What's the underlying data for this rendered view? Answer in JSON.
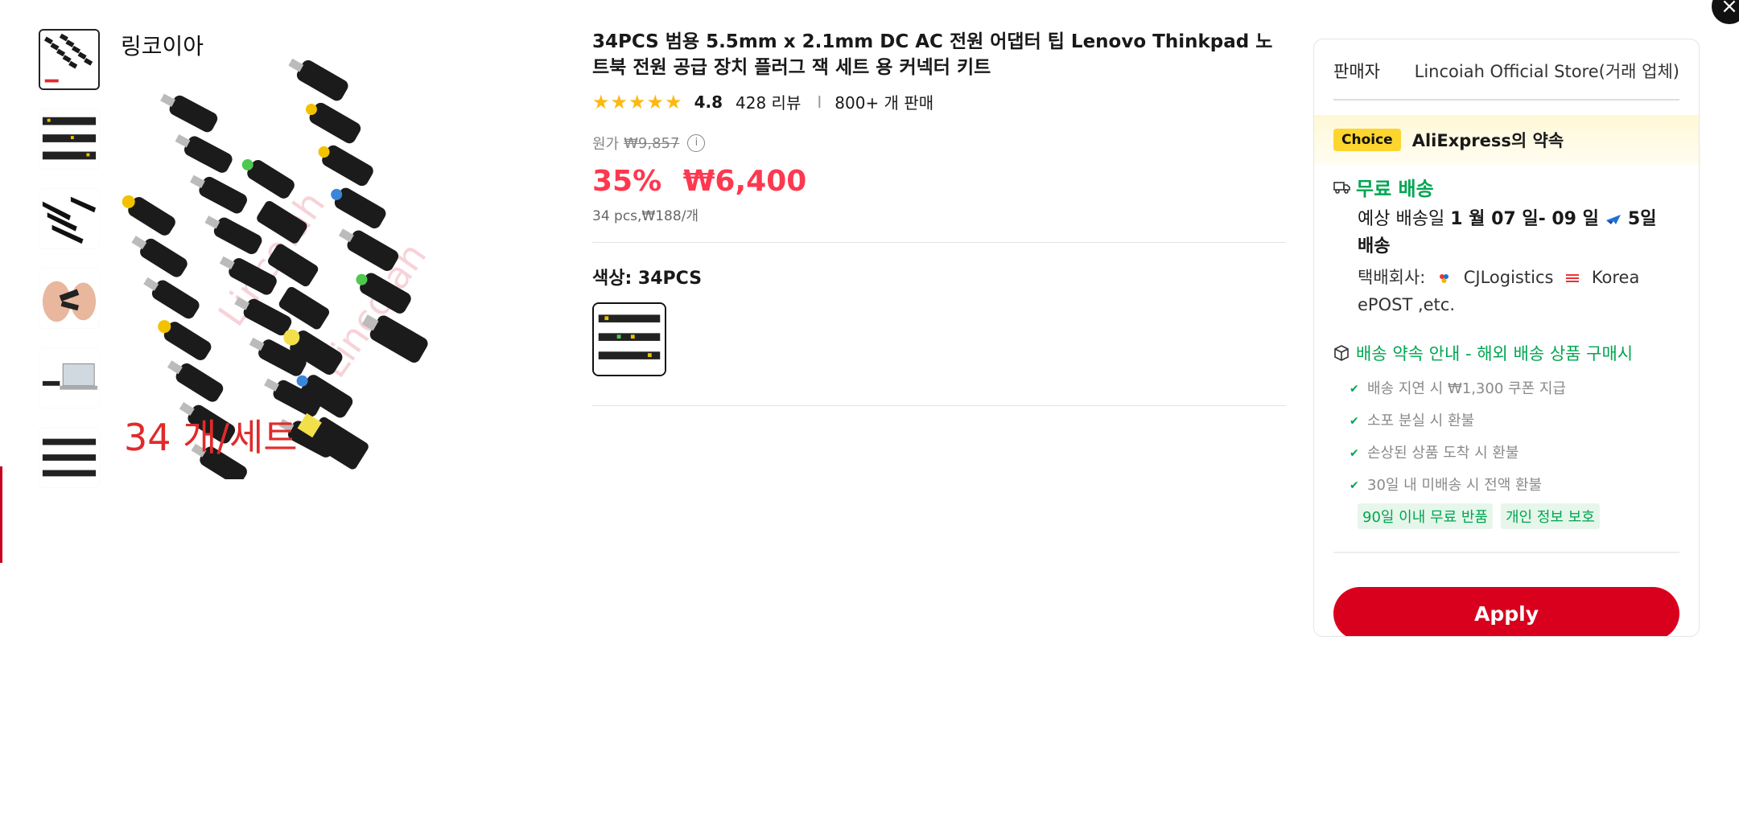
{
  "modal": {
    "close_label": "×"
  },
  "gallery": {
    "brand_text": "링코이아",
    "count_text": "34 개/세트",
    "thumbnails": [
      "thumb-1",
      "thumb-2",
      "thumb-3",
      "thumb-4",
      "thumb-5",
      "thumb-6"
    ]
  },
  "product": {
    "title": "34PCS 범용 5.5mm x 2.1mm DC AC 전원 어댑터 팁 Lenovo Thinkpad 노트북 전원 공급 장치 플러그 잭 세트 용 커넥터 키트",
    "stars": "★★★★★",
    "rating": "4.8",
    "reviews": "428 리뷰",
    "separator": "I",
    "sold": "800+ 개 판매",
    "orig_label": "원가",
    "orig_price": "₩9,857",
    "info_icon": "i",
    "discount": "35%",
    "price": "₩6,400",
    "unit_price": "34 pcs,₩188/개",
    "color_label": "색상: 34PCS"
  },
  "card": {
    "seller_label": "판매자",
    "seller_name": "Lincoiah Official Store(거래 업체)",
    "choice_badge": "Choice",
    "choice_text": "AliExpress의 약속",
    "ship_title": "무료 배송",
    "delivery_prefix": "예상 배송일",
    "delivery_dates": "1 월 07 일- 09 일",
    "delivery_days": "5일",
    "delivery_suffix": "배송",
    "courier_label": "택배회사:",
    "courier_1": "CJLogistics",
    "courier_2": "Korea ePOST ,etc.",
    "promise_title": "배송 약속 안내 - 해외 배송 상품 구매시",
    "promises": [
      "배송 지연 시 ₩1,300 쿠폰 지급",
      "소포 분실 시 환불",
      "손상된 상품 도착 시 환불",
      "30일 내 미배송 시 전액 환불"
    ],
    "tags": [
      "90일 이내 무료 반품",
      "개인 정보 보호"
    ],
    "apply_label": "Apply"
  },
  "colors": {
    "accent": "#d8001d",
    "price": "#fd384f",
    "green": "#00a651",
    "star": "#fdb813",
    "choice": "#fdd52f"
  }
}
